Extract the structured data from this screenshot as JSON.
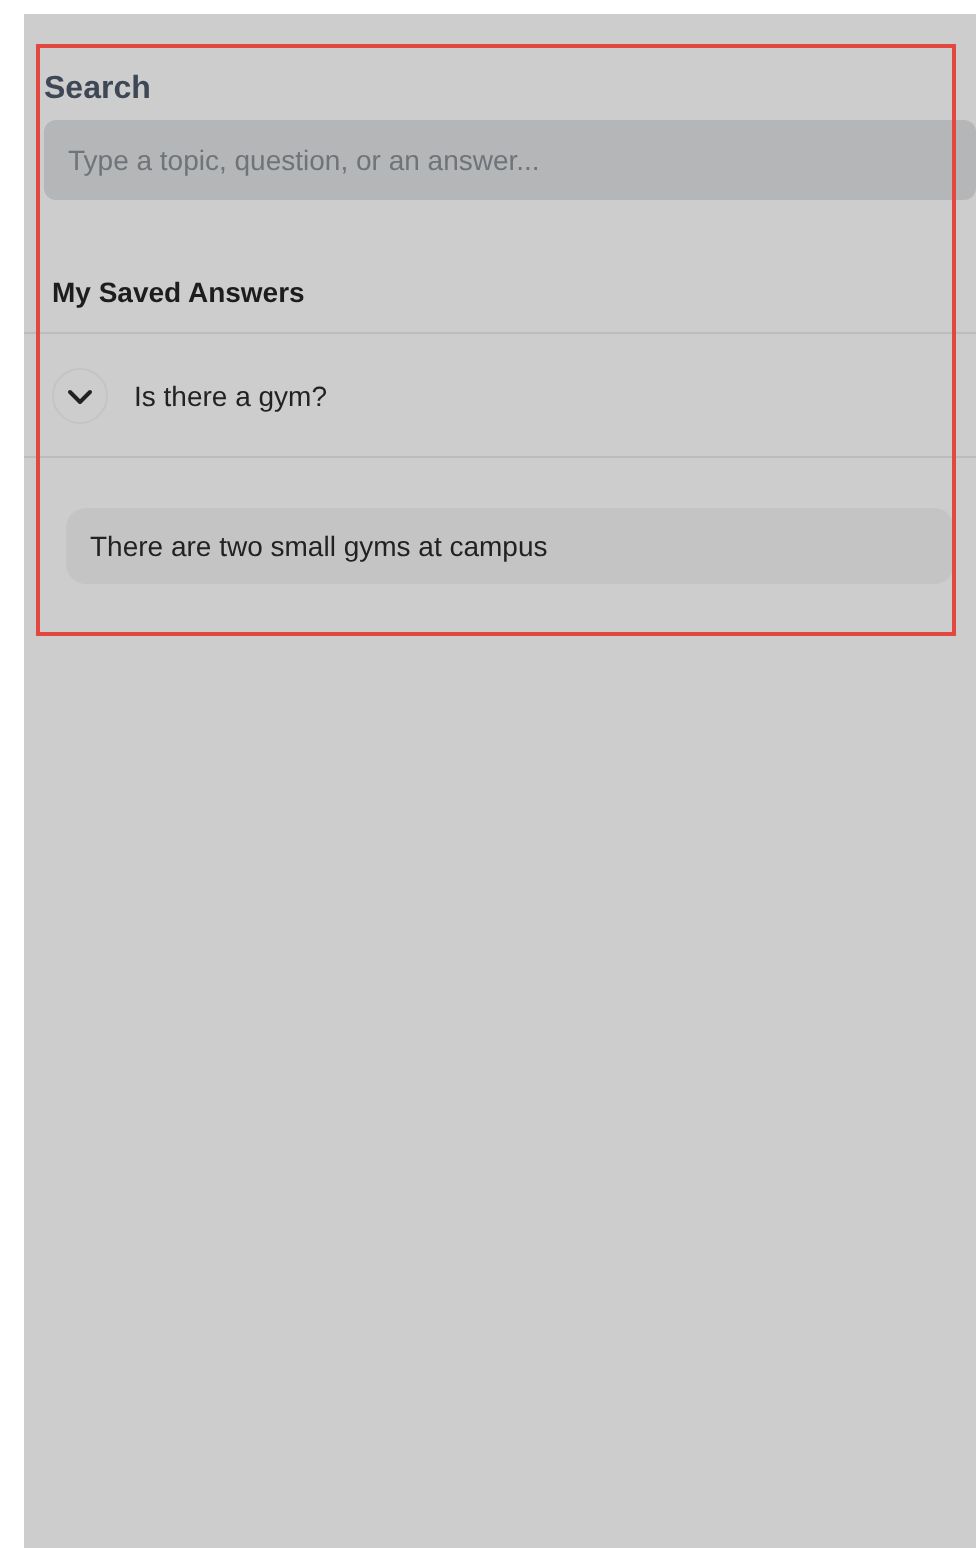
{
  "search": {
    "label": "Search",
    "placeholder": "Type a topic, question, or an answer..."
  },
  "saved": {
    "heading": "My Saved Answers",
    "items": [
      {
        "question": "Is there a gym?",
        "expanded": true,
        "answer": "There are two small gyms at campus"
      }
    ]
  }
}
